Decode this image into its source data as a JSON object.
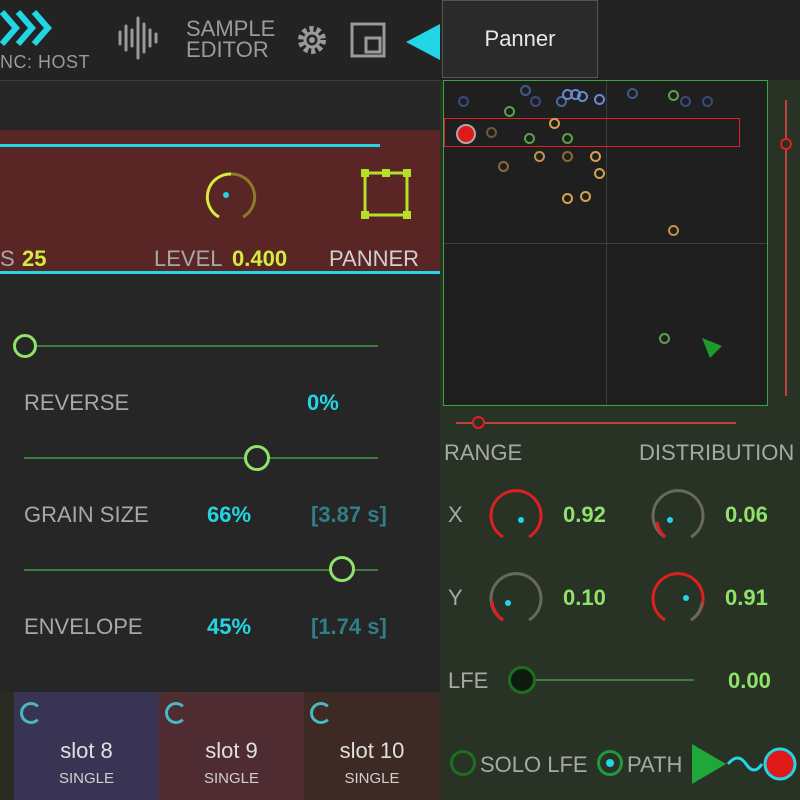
{
  "topbar": {
    "host_sync": "NC: HOST",
    "sample_editor_line1": "SAMPLE",
    "sample_editor_line2": "EDITOR",
    "panner_tab": "Panner"
  },
  "grain": {
    "count_label_tail": "S",
    "count_value": "25",
    "level_label": "LEVEL",
    "level_value": "0.400",
    "panner_label": "PANNER",
    "reverse_label": "REVERSE",
    "reverse_value": "0%",
    "grain_size_label": "GRAIN SIZE",
    "grain_size_value": "66%",
    "grain_size_seconds": "[3.87 s]",
    "envelope_label": "ENVELOPE",
    "envelope_value": "45%",
    "envelope_seconds": "[1.74 s]"
  },
  "panner": {
    "range_label": "RANGE",
    "distribution_label": "DISTRIBUTION",
    "x_label": "X",
    "y_label": "Y",
    "range_x": "0.92",
    "range_y": "0.10",
    "dist_x": "0.06",
    "dist_y": "0.91",
    "lfe_label": "LFE",
    "lfe_value": "0.00",
    "solo_lfe_label": "SOLO LFE",
    "path_label": "PATH"
  },
  "slots": [
    {
      "name": "slot 8",
      "mode": "SINGLE",
      "color": "#3a3454"
    },
    {
      "name": "slot 9",
      "mode": "SINGLE",
      "color": "#4e2c32"
    },
    {
      "name": "slot 10",
      "mode": "SINGLE",
      "color": "#3e2a25"
    }
  ],
  "colors": {
    "accent": "#22d6e6",
    "green": "#8fe36a",
    "yellow": "#d4ec3f",
    "red": "#e02020"
  }
}
